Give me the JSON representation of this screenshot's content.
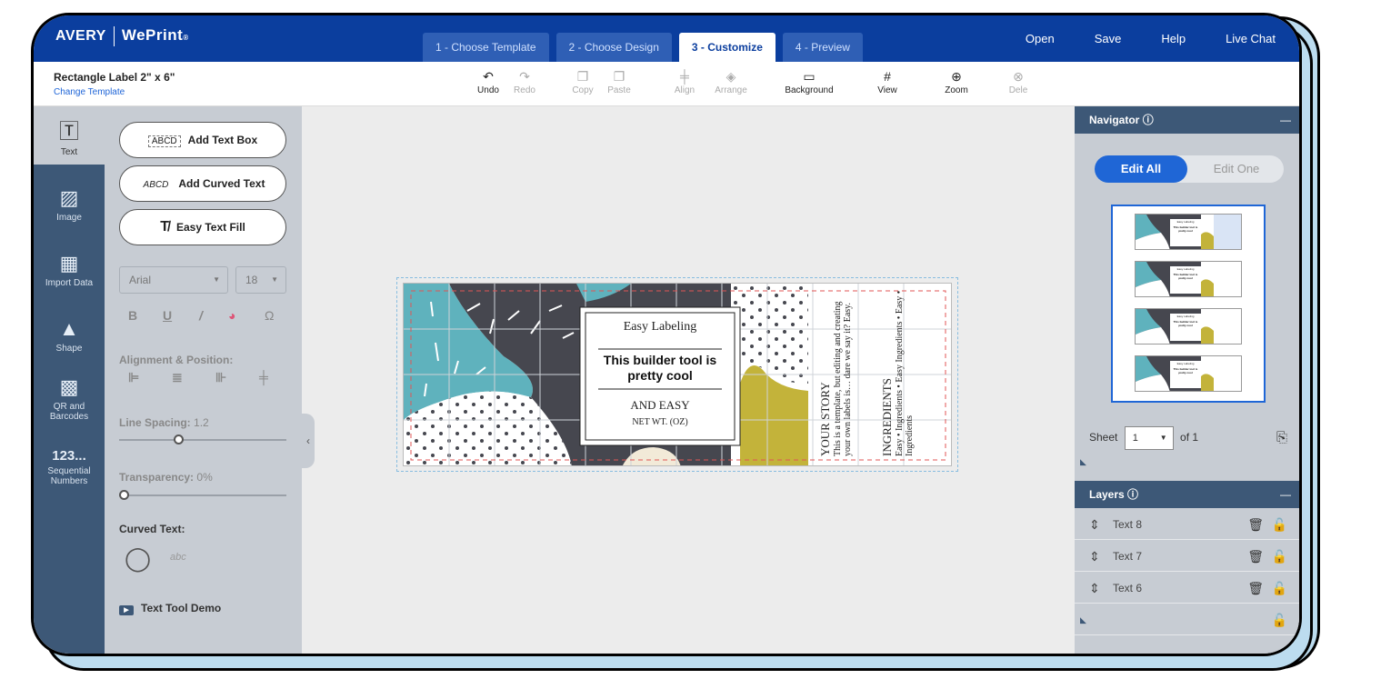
{
  "app": {
    "brand": "AVERY",
    "product": "WePrint",
    "product_mark": "®"
  },
  "steps": [
    {
      "label": "1 - Choose Template"
    },
    {
      "label": "2 - Choose Design"
    },
    {
      "label": "3 - Customize"
    },
    {
      "label": "4 - Preview"
    }
  ],
  "topnav": {
    "open": "Open",
    "save": "Save",
    "help": "Help",
    "live_chat": "Live Chat"
  },
  "document": {
    "title": "Rectangle Label 2\" x 6\"",
    "change_template": "Change Template"
  },
  "toolbar": {
    "undo": "Undo",
    "redo": "Redo",
    "copy": "Copy",
    "paste": "Paste",
    "align": "Align",
    "arrange": "Arrange",
    "background": "Background",
    "view": "View",
    "zoom": "Zoom",
    "delete": "Dele"
  },
  "leftnav": {
    "text": "Text",
    "image": "Image",
    "import_data": "Import Data",
    "shape": "Shape",
    "qr": "QR and Barcodes",
    "sequential": "Sequential Numbers",
    "sequential_icon": "123..."
  },
  "text_panel": {
    "add_text_box": "Add Text Box",
    "add_text_box_icon": "ABCD",
    "add_curved_text": "Add Curved Text",
    "add_curved_text_icon": "ABCD",
    "easy_text_fill": "Easy Text Fill",
    "font": "Arial",
    "font_size": "18",
    "bold": "B",
    "underline": "U",
    "italic": "/",
    "special_char": "Ω",
    "alignment_label": "Alignment & Position:",
    "line_spacing_label": "Line Spacing:",
    "line_spacing_value": "1.2",
    "transparency_label": "Transparency:",
    "transparency_value": "0%",
    "curved_text_label": "Curved Text:",
    "curved_icon": "abc",
    "demo": "Text Tool Demo"
  },
  "label_design": {
    "line1": "Easy Labeling",
    "headline": "This builder tool is pretty cool",
    "line3": "AND EASY",
    "line4": "NET WT. (OZ)",
    "story_title": "YOUR STORY",
    "story_text": "This is a template, but editing and creating your own labels is… dare we say it? Easy.",
    "ingredients_title": "INGREDIENTS",
    "ingredients_text": "Easy • Ingredients • Easy Ingredients • Easy • Ingredients"
  },
  "thumbnail_text": {
    "line1": "Easy Labeling",
    "headline": "This builder tool is pretty cool"
  },
  "navigator": {
    "title": "Navigator",
    "edit_all": "Edit All",
    "edit_one": "Edit One",
    "sheet_label": "Sheet",
    "sheet_value": "1",
    "of_label": "of 1"
  },
  "layers": {
    "title": "Layers",
    "items": [
      {
        "label": "Text 8"
      },
      {
        "label": "Text 7"
      },
      {
        "label": "Text 6"
      }
    ]
  },
  "colors": {
    "brand_blue": "#0b3e9e",
    "accent_blue": "#1f66d6",
    "sidebar": "#3d5877",
    "panel": "#c7ccd3",
    "teal": "#5fb2bd",
    "charcoal": "#46474f",
    "mustard": "#c3b33a"
  }
}
